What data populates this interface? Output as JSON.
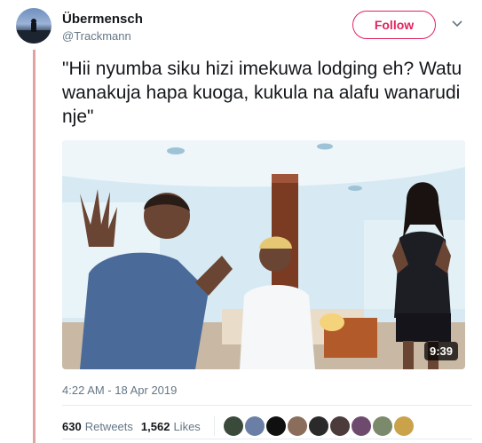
{
  "user": {
    "display_name": "Übermensch",
    "handle": "@Trackmann"
  },
  "follow_button": {
    "label": "Follow"
  },
  "tweet": {
    "text": "\"Hii nyumba siku hizi imekuwa lodging eh? Watu wanakuja hapa kuoga, kukula na alafu wanarudi nje\"",
    "timestamp": "4:22 AM - 18 Apr 2019"
  },
  "media": {
    "duration": "9:39"
  },
  "stats": {
    "retweets_count": "630",
    "retweets_label": "Retweets",
    "likes_count": "1,562",
    "likes_label": "Likes"
  },
  "likers_colors": [
    "#3a4a3a",
    "#6b7fa6",
    "#101010",
    "#8a6d5a",
    "#2a2a2a",
    "#4b3b3b",
    "#6e4b6e",
    "#7a8a6a",
    "#c9a24a"
  ],
  "colors": {
    "accent": "#e0245e",
    "thread_line": "#e1a2a2"
  }
}
